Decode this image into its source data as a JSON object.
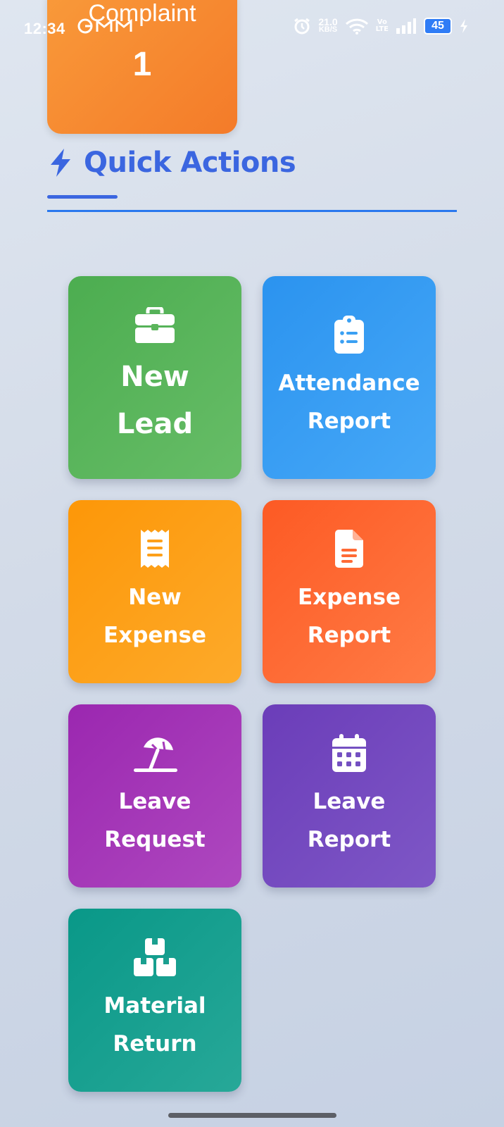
{
  "status_bar": {
    "time": "12:34",
    "net_speed_value": "21.0",
    "net_speed_unit": "KB/S",
    "volte_top": "Vo",
    "volte_bottom": "LTE",
    "battery": "45"
  },
  "stat_card": {
    "label": "Complaint",
    "value": "1"
  },
  "section": {
    "title": "Quick Actions",
    "accent_color": "#3b66e0"
  },
  "actions": [
    {
      "label": "New\nLead",
      "icon": "briefcase-icon",
      "color": "#4cad50"
    },
    {
      "label": "Attendance\nReport",
      "icon": "clipboard-list-icon",
      "color": "#2b93ef"
    },
    {
      "label": "New\nExpense",
      "icon": "receipt-icon",
      "color": "#fd9708"
    },
    {
      "label": "Expense\nReport",
      "icon": "file-text-icon",
      "color": "#fd5a24"
    },
    {
      "label": "Leave\nRequest",
      "icon": "umbrella-beach-icon",
      "color": "#9b27b0"
    },
    {
      "label": "Leave\nReport",
      "icon": "calendar-icon",
      "color": "#6b3db9"
    },
    {
      "label": "Material\nReturn",
      "icon": "boxes-icon",
      "color": "#099888"
    }
  ]
}
